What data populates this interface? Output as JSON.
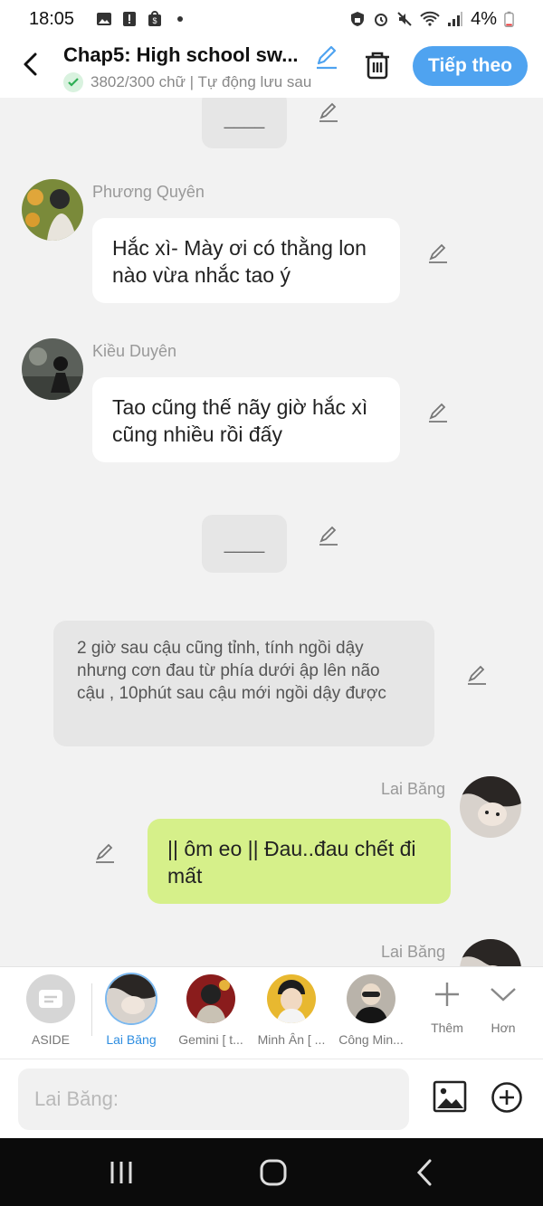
{
  "status_bar": {
    "time": "18:05",
    "battery": "4%"
  },
  "header": {
    "title": "Chap5: High school sw...",
    "word_count": "3802/300 chữ | Tự động lưu sau",
    "next_label": "Tiếp theo"
  },
  "chat": {
    "top_placeholder": "____",
    "mid_placeholder": "____",
    "messages": [
      {
        "sender": "Phương Quyên",
        "text": "Hắc xì- Mày ơi có thằng lon nào vừa nhắc tao ý"
      },
      {
        "sender": "Kiều Duyên",
        "text": "Tao cũng thế nãy giờ hắc xì cũng nhiều rồi đấy"
      }
    ],
    "narration": "2 giờ sau cậu cũng tỉnh, tính ngồi dậy nhưng cơn đau từ phía dưới ập lên não cậu , 10phút sau cậu mới ngồi dậy được",
    "self_messages": [
      {
        "sender": "Lai Băng",
        "text": "|| ôm eo || Đau..đau chết đi mất"
      },
      {
        "sender": "Lai Băng"
      }
    ]
  },
  "characters": [
    {
      "label": "ASIDE"
    },
    {
      "label": "Lai Băng"
    },
    {
      "label": "Gemini [ t..."
    },
    {
      "label": "Minh Ân [ ..."
    },
    {
      "label": "Công Min..."
    }
  ],
  "tools": {
    "more_label": "Thêm",
    "expand_label": "Hơn"
  },
  "input": {
    "placeholder": "Lai Băng:"
  },
  "colors": {
    "accent": "#4fa3f0",
    "self_bubble": "#d6f08a",
    "active_char": "#2d8de0"
  }
}
